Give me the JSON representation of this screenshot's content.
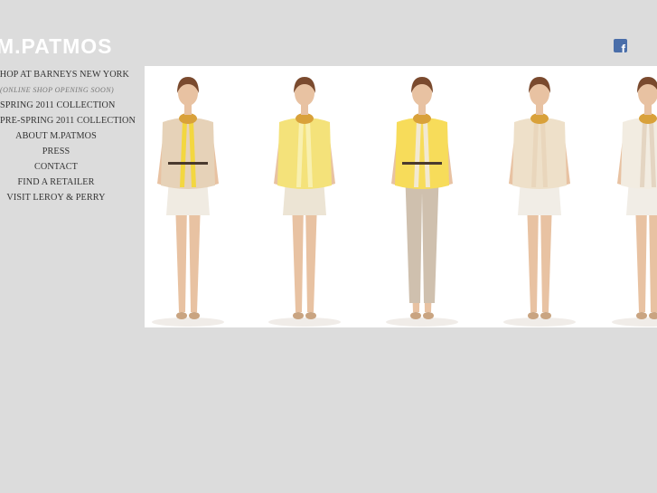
{
  "brand": {
    "logo_text": "M.PATMOS"
  },
  "social": {
    "icon": "facebook-icon"
  },
  "nav": {
    "items": [
      "SHOP AT BARNEYS NEW YORK",
      "(ONLINE SHOP OPENING SOON)",
      "SPRING 2011 COLLECTION",
      "PRE-SPRING 2011 COLLECTION",
      "ABOUT M.PATMOS",
      "PRESS",
      "CONTACT",
      "FIND A RETAILER",
      "VISIT LEROY & PERRY"
    ]
  },
  "gallery": {
    "models": [
      {
        "top": "#e6d2b8",
        "accent": "#f3d740",
        "bottom": "#f0ebe2",
        "long_bottom": false,
        "belt": true
      },
      {
        "top": "#f4e27a",
        "accent": "#f8f0b0",
        "bottom": "#ece4d4",
        "long_bottom": false,
        "belt": false
      },
      {
        "top": "#f7dc5a",
        "accent": "#f2e9d2",
        "bottom": "#cfc0ae",
        "long_bottom": true,
        "belt": true
      },
      {
        "top": "#eee0c9",
        "accent": "#e9d6bc",
        "bottom": "#f1ede6",
        "long_bottom": false,
        "belt": false
      },
      {
        "top": "#f2ece1",
        "accent": "#e4d5c2",
        "bottom": "#f1ede6",
        "long_bottom": false,
        "belt": false
      }
    ]
  }
}
